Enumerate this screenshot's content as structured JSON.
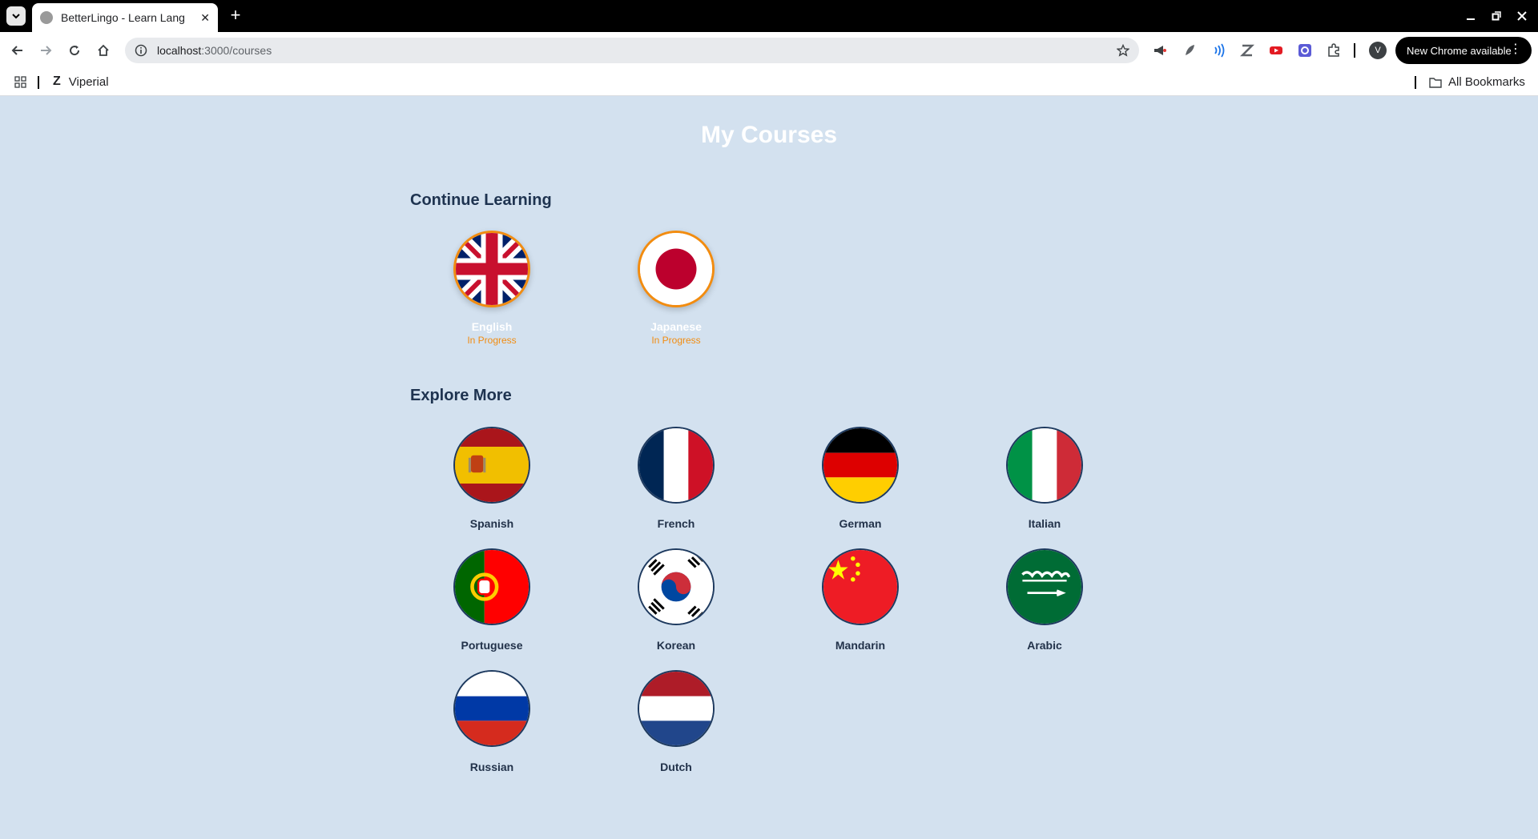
{
  "browser": {
    "tab_title": "BetterLingo - Learn Lang",
    "url_host": "localhost",
    "url_path": ":3000/courses",
    "update_label": "New Chrome available",
    "avatar_letter": "V"
  },
  "bookmarks": {
    "items": [
      {
        "logo": "Z",
        "label": "Viperial"
      }
    ],
    "all_label": "All Bookmarks"
  },
  "page": {
    "title": "My Courses",
    "continue_title": "Continue Learning",
    "explore_title": "Explore More",
    "status_label": "In Progress",
    "continue": [
      {
        "name": "English"
      },
      {
        "name": "Japanese"
      }
    ],
    "explore": [
      {
        "name": "Spanish"
      },
      {
        "name": "French"
      },
      {
        "name": "German"
      },
      {
        "name": "Italian"
      },
      {
        "name": "Portuguese"
      },
      {
        "name": "Korean"
      },
      {
        "name": "Mandarin"
      },
      {
        "name": "Arabic"
      },
      {
        "name": "Russian"
      },
      {
        "name": "Dutch"
      }
    ]
  },
  "colors": {
    "background": "#d3e1ef",
    "accent": "#f28c10",
    "heading": "#1e3350"
  }
}
